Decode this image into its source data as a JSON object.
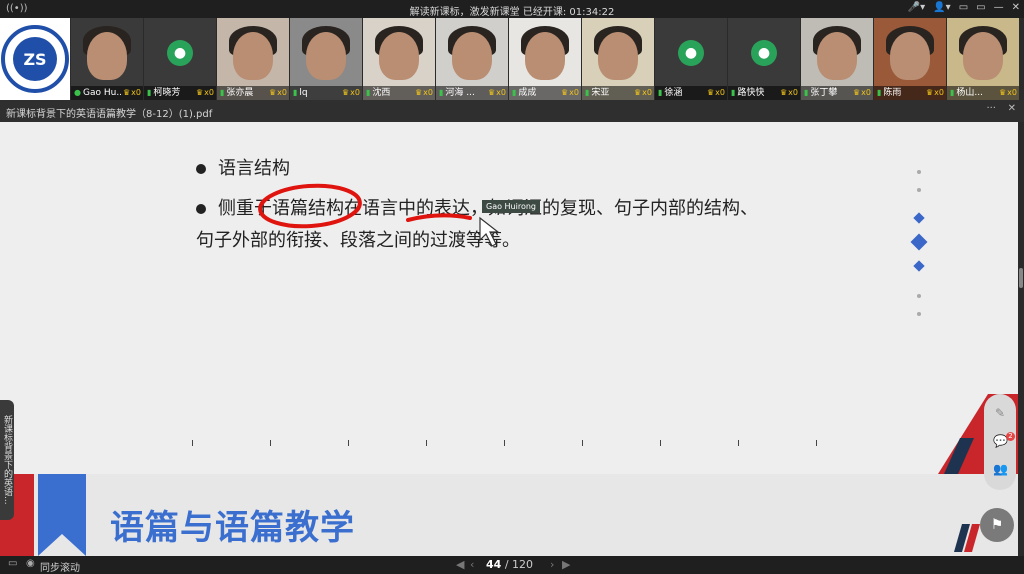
{
  "topbar": {
    "center_text": "解读新课标，激发新课堂   已经开课: 01:34:22",
    "controls": [
      "🎤▾",
      "👤▾",
      "▭",
      "▭",
      "—",
      "✕"
    ]
  },
  "participants": [
    {
      "name": "Gao Hu...",
      "count": "x0",
      "type": "video"
    },
    {
      "name": "柯晓芳",
      "count": "x0",
      "type": "avatar"
    },
    {
      "name": "张亦晨",
      "count": "x0",
      "type": "video"
    },
    {
      "name": "lq",
      "count": "x0",
      "type": "video"
    },
    {
      "name": "沈西",
      "count": "x0",
      "type": "video"
    },
    {
      "name": "河海 ...",
      "count": "x0",
      "type": "video"
    },
    {
      "name": "成成",
      "count": "x0",
      "type": "video"
    },
    {
      "name": "宋亚",
      "count": "x0",
      "type": "video"
    },
    {
      "name": "徐涵",
      "count": "x0",
      "type": "avatar"
    },
    {
      "name": "路快快",
      "count": "x0",
      "type": "avatar"
    },
    {
      "name": "张丁攀",
      "count": "x0",
      "type": "video"
    },
    {
      "name": "陈雨",
      "count": "x0",
      "type": "video"
    },
    {
      "name": "杨山...",
      "count": "x0",
      "type": "video"
    }
  ],
  "doc": {
    "title": "新课标背景下的英语语篇教学（8-12）(1).pdf",
    "more": "···",
    "close": "✕"
  },
  "slide": {
    "bullet1": "语言结构",
    "bullet2_line1": "侧重于语篇结构在语言中的表达，如词汇的复现、句子内部的结构、",
    "bullet2_line2": "句子外部的衔接、段落之间的过渡等等。",
    "heading": "语篇与语篇教学",
    "cursor_label": "Gao Huirong",
    "side_tab": "新课标背景下的英语..."
  },
  "tools": {
    "edit": "✎",
    "chat": "💬",
    "chat_badge": "2",
    "people": "👥"
  },
  "bottombar": {
    "sync_label": "同步滚动",
    "current_page": "44",
    "total_pages": "/ 120"
  },
  "colors": {
    "accent_blue": "#3b6fcf",
    "accent_red": "#c8262a",
    "dark_navy": "#1e3350"
  }
}
